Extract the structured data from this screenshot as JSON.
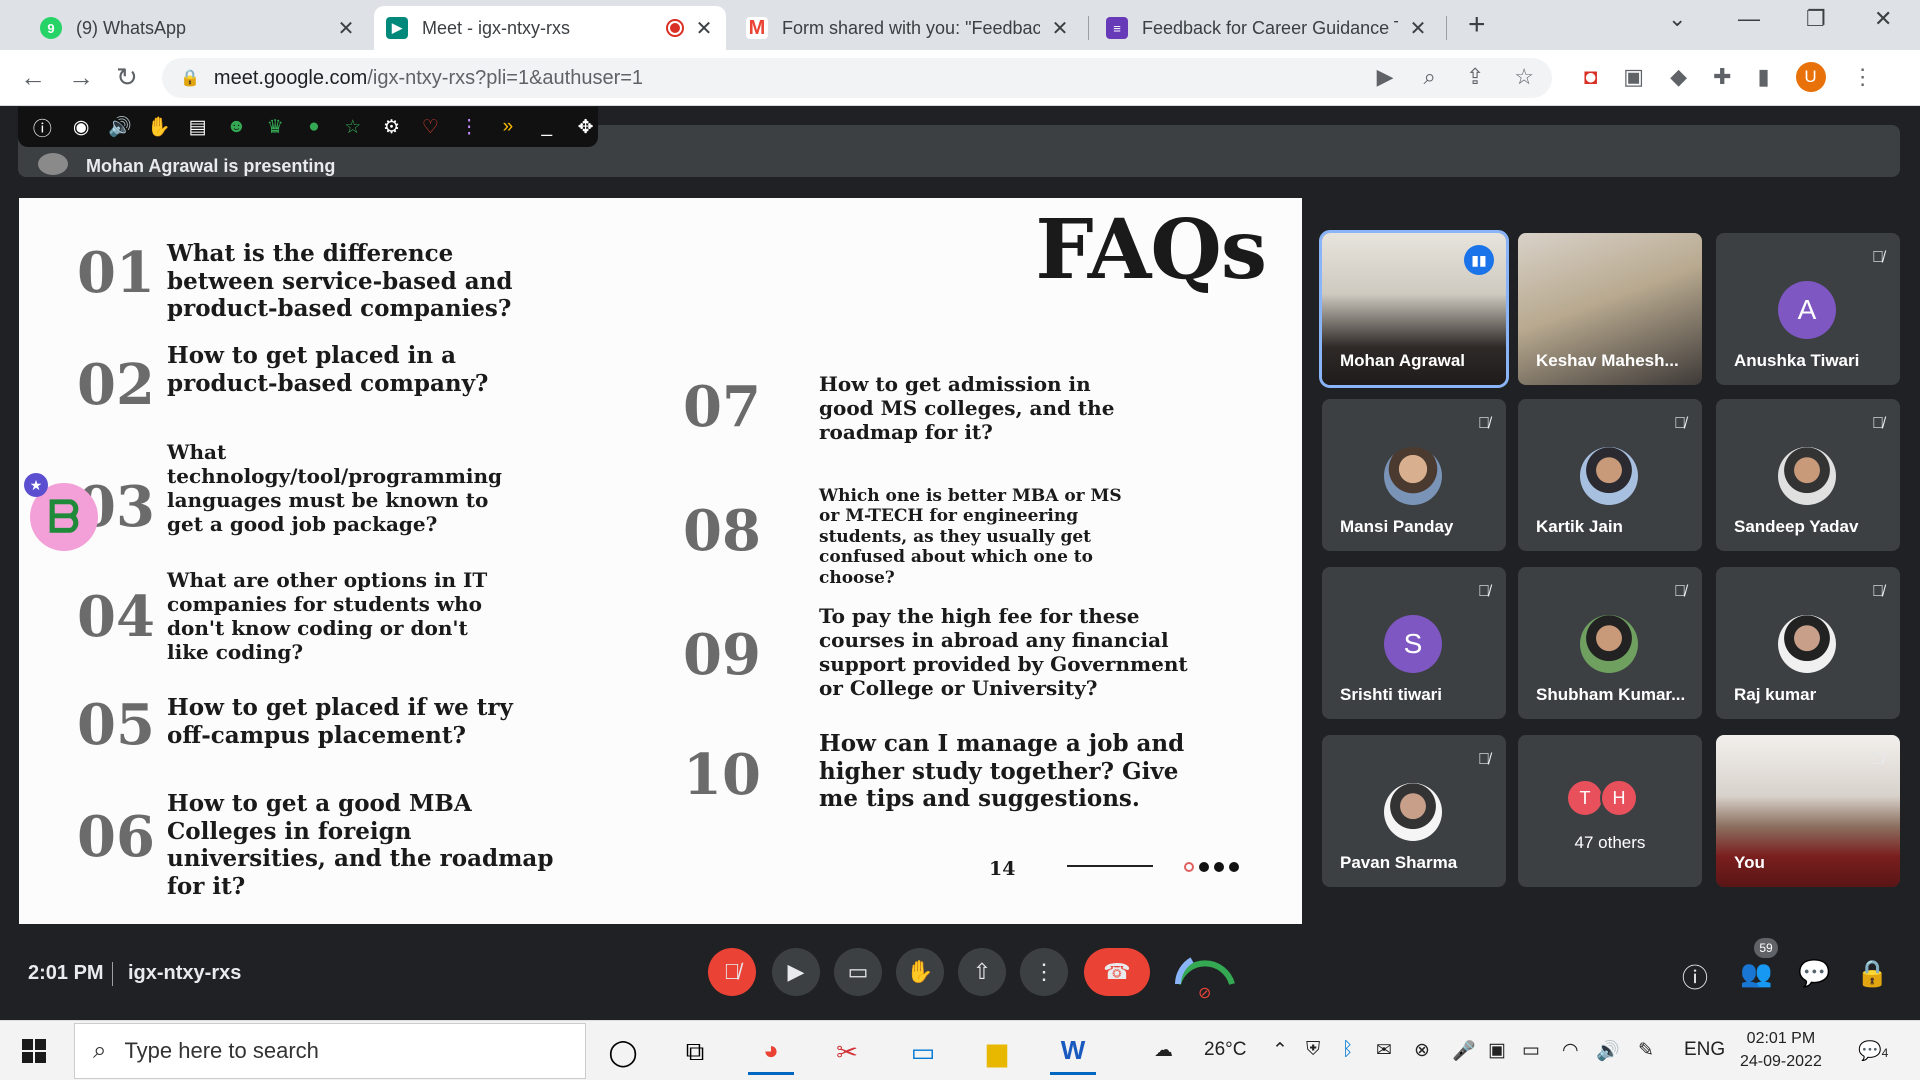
{
  "browser": {
    "tabs": [
      {
        "title": "(9) WhatsApp",
        "icon": "whatsapp-icon",
        "color": "#25d366",
        "glyph": "9"
      },
      {
        "title": "Meet - igx-ntxy-rxs",
        "icon": "meet-icon",
        "color": "#00897b",
        "glyph": "▶"
      },
      {
        "title": "Form shared with you: \"Feedback",
        "icon": "gmail-icon",
        "color": "#ea4335",
        "glyph": "M"
      },
      {
        "title": "Feedback for Career Guidance Ta",
        "icon": "forms-icon",
        "color": "#673ab7",
        "glyph": "≡"
      }
    ],
    "url_host": "meet.google.com",
    "url_path": "/igx-ntxy-rxs?pli=1&authuser=1",
    "profile_initial": "U"
  },
  "meet": {
    "presenting_text": "Mohan Agrawal is presenting",
    "time": "2:01 PM",
    "meeting_code": "igx-ntxy-rxs",
    "participant_count": "59"
  },
  "slide": {
    "title": "FAQs",
    "page_number": "14",
    "faqs": [
      {
        "num": "01",
        "q": "What is the difference between service-based and product-based companies?"
      },
      {
        "num": "02",
        "q": "How to get placed in a product-based company?"
      },
      {
        "num": "03",
        "q": "What technology/tool/programming languages must be known to get a good job package?"
      },
      {
        "num": "04",
        "q": "What are other options in IT companies for students who don't know coding or don't like coding?"
      },
      {
        "num": "05",
        "q": "How to get placed if we try off-campus placement?"
      },
      {
        "num": "06",
        "q": "How to get a good MBA Colleges in foreign universities, and the roadmap for it?"
      },
      {
        "num": "07",
        "q": "How to get admission in good MS colleges, and the roadmap for it?"
      },
      {
        "num": "08",
        "q": "Which one is better MBA or MS or M-TECH for engineering students, as they usually get confused about which one to choose?"
      },
      {
        "num": "09",
        "q": "To pay the high fee for these courses in abroad any financial support provided by Government or College or University?"
      },
      {
        "num": "10",
        "q": "How can I manage a job and higher study together? Give me tips and suggestions."
      }
    ]
  },
  "participants": [
    {
      "name": "Mohan Agrawal",
      "type": "video",
      "speaking": true
    },
    {
      "name": "Keshav Mahesh...",
      "type": "video"
    },
    {
      "name": "Anushka Tiwari",
      "type": "initial",
      "initial": "A",
      "color": "#7e57c2",
      "muted": true
    },
    {
      "name": "Mansi Panday",
      "type": "photo",
      "muted": true
    },
    {
      "name": "Kartik Jain",
      "type": "photo",
      "muted": true
    },
    {
      "name": "Sandeep Yadav",
      "type": "photo",
      "muted": true
    },
    {
      "name": "Srishti tiwari",
      "type": "initial",
      "initial": "S",
      "color": "#7e57c2",
      "muted": true
    },
    {
      "name": "Shubham Kumar...",
      "type": "photo",
      "muted": true
    },
    {
      "name": "Raj kumar",
      "type": "photo",
      "muted": true
    },
    {
      "name": "Pavan Sharma",
      "type": "photo",
      "muted": true
    },
    {
      "name": "47 others",
      "type": "others",
      "initials": [
        "T",
        "H"
      ]
    },
    {
      "name": "You",
      "type": "video",
      "muted": true
    }
  ],
  "taskbar": {
    "search_placeholder": "Type here to search",
    "weather": "26°C",
    "language": "ENG",
    "time": "02:01 PM",
    "date": "24-09-2022",
    "notifications": "4"
  }
}
